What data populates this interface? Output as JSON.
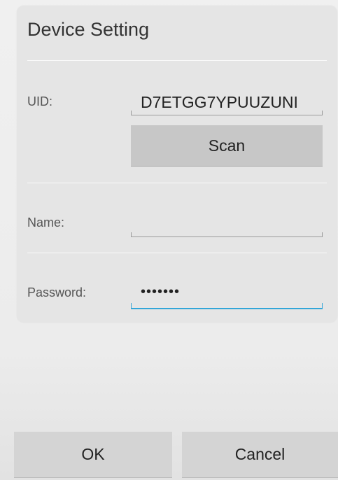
{
  "dialog": {
    "title": "Device Setting"
  },
  "form": {
    "uid_label": "UID:",
    "uid_value": "D7ETGG7YPUUZUNI",
    "scan_label": "Scan",
    "name_label": "Name:",
    "name_value": "",
    "password_label": "Password:",
    "password_value": "•••••••"
  },
  "actions": {
    "ok_label": "OK",
    "cancel_label": "Cancel"
  },
  "colors": {
    "focus_accent": "#33a6d8",
    "button_bg": "#c7c7c7"
  }
}
